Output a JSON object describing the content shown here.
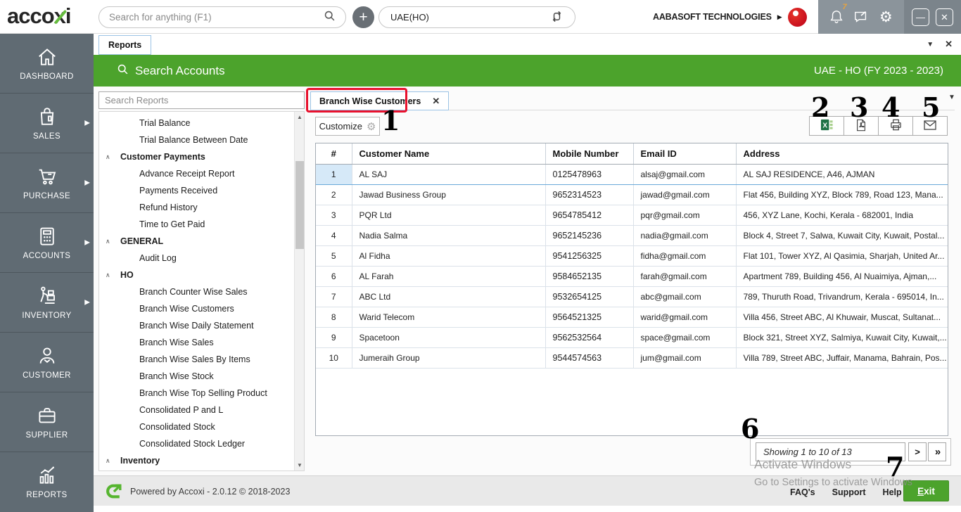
{
  "header": {
    "logo_text": "accoxi",
    "search_placeholder": "Search for anything (F1)",
    "branch_selector_value": "UAE(HO)",
    "company_name": "AABASOFT TECHNOLOGIES",
    "notification_count": "7"
  },
  "icons": {
    "plus": "+",
    "company-caret": "▶",
    "gear": "⚙",
    "tab-dropdown": "▼",
    "tab-close": "✕",
    "report-tab-close": "✕",
    "export-dropdown": "▼",
    "minimize": "—",
    "close": "✕",
    "section-collapse": "∧",
    "sidebar-arrow": "▶"
  },
  "tab_bar": {
    "active_tab": "Reports"
  },
  "green_bar": {
    "title": "Search Accounts",
    "fiscal_label": "UAE - HO (FY 2023 - 2023)"
  },
  "sidebar": {
    "items": [
      {
        "label": "DASHBOARD",
        "icon": "home-icon",
        "has_arrow": false
      },
      {
        "label": "SALES",
        "icon": "sales-bag-icon",
        "has_arrow": true
      },
      {
        "label": "PURCHASE",
        "icon": "purchase-cart-icon",
        "has_arrow": true
      },
      {
        "label": "ACCOUNTS",
        "icon": "accounts-calculator-icon",
        "has_arrow": true
      },
      {
        "label": "INVENTORY",
        "icon": "inventory-trolley-icon",
        "has_arrow": true
      },
      {
        "label": "CUSTOMER",
        "icon": "customer-person-icon",
        "has_arrow": false
      },
      {
        "label": "SUPPLIER",
        "icon": "supplier-briefcase-icon",
        "has_arrow": false
      },
      {
        "label": "REPORTS",
        "icon": "reports-chart-icon",
        "has_arrow": false
      }
    ]
  },
  "reports_panel": {
    "search_placeholder": "Search Reports",
    "items": [
      {
        "label": "Trial Balance",
        "type": "child"
      },
      {
        "label": "Trial Balance Between Date",
        "type": "child"
      },
      {
        "label": "Customer Payments",
        "type": "section"
      },
      {
        "label": "Advance Receipt Report",
        "type": "child"
      },
      {
        "label": "Payments Received",
        "type": "child"
      },
      {
        "label": "Refund History",
        "type": "child"
      },
      {
        "label": "Time to Get Paid",
        "type": "child"
      },
      {
        "label": "GENERAL",
        "type": "section"
      },
      {
        "label": "Audit Log",
        "type": "child"
      },
      {
        "label": "HO",
        "type": "section"
      },
      {
        "label": "Branch Counter Wise Sales",
        "type": "child"
      },
      {
        "label": "Branch Wise Customers",
        "type": "child"
      },
      {
        "label": "Branch Wise Daily Statement",
        "type": "child"
      },
      {
        "label": "Branch Wise Sales",
        "type": "child"
      },
      {
        "label": "Branch Wise Sales By Items",
        "type": "child"
      },
      {
        "label": "Branch Wise Stock",
        "type": "child"
      },
      {
        "label": "Branch Wise Top Selling Product",
        "type": "child"
      },
      {
        "label": "Consolidated P and L",
        "type": "child"
      },
      {
        "label": "Consolidated Stock",
        "type": "child"
      },
      {
        "label": "Consolidated Stock Ledger",
        "type": "child"
      },
      {
        "label": "Inventory",
        "type": "section"
      }
    ]
  },
  "report": {
    "tab_title": "Branch Wise Customers",
    "customize_label": "Customize",
    "export_buttons": [
      {
        "name": "excel-export-button",
        "icon": "excel-icon"
      },
      {
        "name": "pdf-export-button",
        "icon": "pdf-icon"
      },
      {
        "name": "print-button",
        "icon": "printer-icon"
      },
      {
        "name": "email-button",
        "icon": "email-icon"
      }
    ],
    "table": {
      "columns": [
        "#",
        "Customer Name",
        "Mobile Number",
        "Email ID",
        "Address"
      ],
      "rows": [
        [
          "1",
          "AL SAJ",
          "0125478963",
          "alsaj@gmail.com",
          "AL SAJ RESIDENCE, A46, AJMAN"
        ],
        [
          "2",
          "Jawad Business Group",
          "9652314523",
          "jawad@gmail.com",
          "Flat 456, Building XYZ, Block 789, Road 123, Mana..."
        ],
        [
          "3",
          "PQR Ltd",
          "9654785412",
          "pqr@gmail.com",
          "456, XYZ Lane, Kochi, Kerala - 682001, India"
        ],
        [
          "4",
          "Nadia Salma",
          "9652145236",
          "nadia@gmail.com",
          "Block 4, Street 7, Salwa, Kuwait City, Kuwait, Postal..."
        ],
        [
          "5",
          "Al Fidha",
          "9541256325",
          "fidha@gmail.com",
          "Flat 101, Tower XYZ, Al Qasimia, Sharjah, United Ar..."
        ],
        [
          "6",
          "AL Farah",
          "9584652135",
          "farah@gmail.com",
          "Apartment 789, Building 456, Al Nuaimiya, Ajman,..."
        ],
        [
          "7",
          "ABC Ltd",
          "9532654125",
          "abc@gmail.com",
          "789, Thuruth Road, Trivandrum, Kerala - 695014, In..."
        ],
        [
          "8",
          "Warid Telecom",
          "9564521325",
          "warid@gmail.com",
          "Villa 456, Street ABC, Al Khuwair, Muscat, Sultanat..."
        ],
        [
          "9",
          "Spacetoon",
          "9562532564",
          "space@gmail.com",
          "Block 321, Street XYZ, Salmiya, Kuwait City, Kuwait,..."
        ],
        [
          "10",
          "Jumeraih Group",
          "9544574563",
          "jum@gmail.com",
          "Villa 789, Street ABC, Juffair, Manama, Bahrain, Pos..."
        ]
      ]
    },
    "pagination": {
      "showing": "Showing 1 to 10 of 13",
      "next": ">",
      "last": "»"
    }
  },
  "annotations": [
    "1",
    "2",
    "3",
    "4",
    "5",
    "6",
    "7"
  ],
  "watermark": {
    "line1": "Activate Windows",
    "line2": "Go to Settings to activate Windows"
  },
  "footer": {
    "powered_by": "Powered by Accoxi - 2.0.12 © 2018-2023",
    "links": [
      "FAQ's",
      "Support",
      "Help"
    ],
    "exit_label": "Exit"
  },
  "colors": {
    "brand_green": "#4ca32c",
    "sidebar_gray": "#606b73",
    "tray_gray": "#8b949b",
    "win_gray": "#7b848b",
    "annotation_red": "#e8112d",
    "excel_green": "#1e7145",
    "selected_cell_blue": "#d6e9f8",
    "selected_border_blue": "#68a8d8",
    "tab_border_blue": "#9cc3e5",
    "badge_orange": "#e8a33d",
    "footer_bg": "#e9e9e9"
  }
}
